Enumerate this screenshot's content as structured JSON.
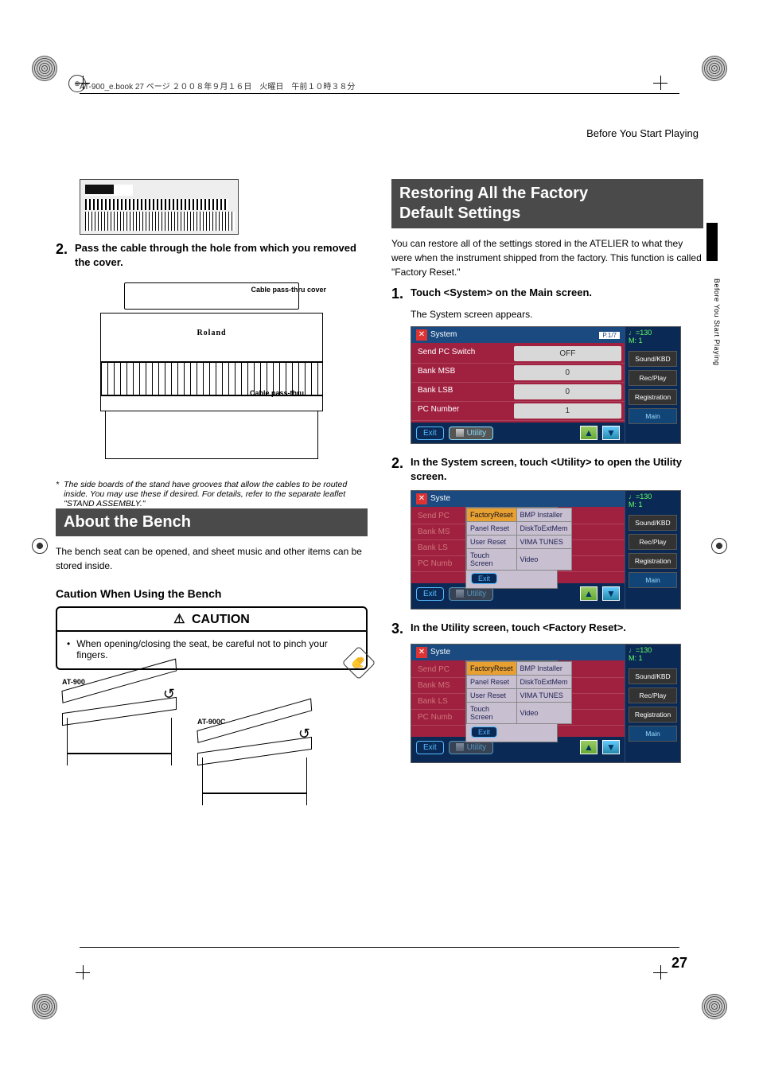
{
  "header": {
    "runner": "AT-900_e.book  27 ページ   ２００８年９月１６日　火曜日　午前１０時３８分"
  },
  "breadcrumb": "Before You Start Playing",
  "side_tab_text": "Before You Start Playing",
  "page_number": "27",
  "left": {
    "step2": {
      "num": "2.",
      "text": "Pass the cable through the hole from which you removed the cover."
    },
    "diagram": {
      "brand": "Roland",
      "label_cover": "Cable pass-thru cover",
      "label_thru": "Cable pass-thru"
    },
    "footnote": {
      "ast": "*",
      "text": "The side boards of the stand have grooves that allow the cables to be routed inside. You may use these if desired. For details, refer to the separate leaflet \"STAND ASSEMBLY.\""
    },
    "section_bench": "About the Bench",
    "bench_intro": "The bench seat can be opened, and sheet music and other items can be stored inside.",
    "bench_subhead": "Caution When Using the Bench",
    "caution": {
      "title": "CAUTION",
      "bullet": "•",
      "text": "When opening/closing the seat, be careful not to pinch your fingers."
    },
    "bench_labels": {
      "a": "AT-900",
      "b": "AT-900C"
    }
  },
  "right": {
    "section_restore_l1": "Restoring All the Factory",
    "section_restore_l2": "Default Settings",
    "intro": "You can restore all of the settings stored in the ATELIER to what they were when the instrument shipped from the factory. This function is called \"Factory Reset.\"",
    "step1": {
      "num": "1.",
      "text": "Touch <System> on the Main screen.",
      "sub": "The System screen appears."
    },
    "step2": {
      "num": "2.",
      "text": "In the System screen, touch <Utility> to open the Utility screen."
    },
    "step3": {
      "num": "3.",
      "text": "In the Utility screen, touch <Factory Reset>."
    },
    "screen_common": {
      "title": "System",
      "pager": "P.1/7",
      "tempo_top": "♩=130",
      "tempo_bot": "M:    1",
      "exit": "Exit",
      "utility": "Utility",
      "side": {
        "sound": "Sound/KBD",
        "rec": "Rec/Play",
        "reg": "Registration",
        "main": "Main"
      }
    },
    "screen1": {
      "rows": [
        {
          "label": "Send PC Switch",
          "value": "OFF"
        },
        {
          "label": "Bank MSB",
          "value": "0"
        },
        {
          "label": "Bank LSB",
          "value": "0"
        },
        {
          "label": "PC Number",
          "value": "1"
        }
      ]
    },
    "screen2": {
      "title_short": "Syste",
      "side_rows": [
        "Send PC",
        "Bank MS",
        "Bank LS",
        "PC Numb"
      ],
      "popup": [
        [
          "FactoryReset",
          "BMP Installer"
        ],
        [
          "Panel Reset",
          "DiskToExtMem"
        ],
        [
          "User Reset",
          "VIMA TUNES"
        ],
        [
          "Touch Screen",
          "Video"
        ]
      ],
      "popup_exit": "Exit",
      "selected": "FactoryReset"
    },
    "screen3": {
      "selected": "FactoryReset"
    }
  }
}
